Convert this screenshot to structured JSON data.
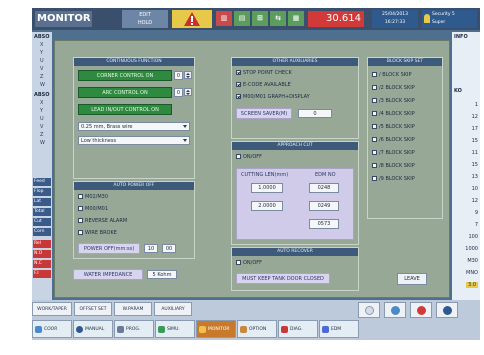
{
  "topbar": {
    "title": "MONITOR",
    "mode_line1": "EDIT",
    "mode_line2": "HOLD",
    "counter": "30.614",
    "clock_line1": "25/04/2013",
    "clock_line2": "16:27:33",
    "user_line1": "Security 5",
    "user_line2": "Super"
  },
  "left_strip": {
    "section1": "ABSO",
    "axes": [
      "X",
      "Y",
      "U",
      "V",
      "Z",
      "W"
    ],
    "section2": "ABSO",
    "axes2": [
      "X",
      "Y",
      "U",
      "V",
      "Z",
      "W"
    ],
    "items": [
      "Feed",
      "Flop",
      "Lat",
      "Total",
      "Cut",
      "Corn",
      "Rel",
      "N.O",
      "N.C",
      "F.I"
    ]
  },
  "right_strip": {
    "header": "INFO",
    "label": "KO",
    "numbers": [
      "1",
      "12",
      "17",
      "15",
      "11",
      "15",
      "13",
      "10",
      "12",
      "9",
      "7",
      "100",
      "1000",
      "M30",
      "MNO",
      "3.0"
    ]
  },
  "panel": {
    "wire_title": "CONTINUOUS FUNCTION",
    "corner_control": "CORNER CONTROL ON",
    "corner_value": "0",
    "arc_control": "ARC CONTROL ON",
    "arc_value": "0",
    "lead_control": "LEAD IN/OUT CONTROL ON",
    "wire_type": "0.25 mm, Brass wire",
    "thickness": "Low thickness",
    "auto_title": "AUTO POWER OFF",
    "auto_checks": [
      {
        "label": "M02/M30",
        "checked": false
      },
      {
        "label": "M00/M01",
        "checked": false
      },
      {
        "label": "REVERSE ALARM",
        "checked": false
      },
      {
        "label": "WIRE BROKE",
        "checked": false
      }
    ],
    "power_off_label": "POWER OFF(mm:ss)",
    "power_off_min": "10",
    "power_off_sec": "00",
    "water_label": "WATER IMPEDANCE",
    "water_value": "5 Kohm",
    "other_title": "OTHER AUXILIARIES",
    "other_checks": [
      {
        "label": "STOP POINT CHECK",
        "checked": true
      },
      {
        "label": "E-CODE AVAILABLE",
        "checked": true
      },
      {
        "label": "M00/M01 GRAPH+DISPLAY",
        "checked": true
      }
    ],
    "screen_saver_label": "SCREEN SAVER(M)",
    "screen_saver_value": "0",
    "approach_title": "APPROACH CUT",
    "approach_check": "ON/OFF",
    "cutting_header": "CUTTING LEN(mm)",
    "edm_header": "EDM NO",
    "cutting_rows": [
      {
        "len": "1.0000",
        "edm": "0248"
      },
      {
        "len": "2.0000",
        "edm": "0249"
      },
      {
        "len": "",
        "edm": "0573"
      }
    ],
    "auto_recover_title": "AUTO RECOVER",
    "recover_check": "ON/OFF",
    "recover_warning": "MUST KEEP TANK DOOR CLOSED",
    "block_title": "BLOCK SKIP SET",
    "block_skips": [
      "/ BLOCK SKIP",
      "/2 BLOCK SKIP",
      "/3 BLOCK SKIP",
      "/4 BLOCK SKIP",
      "/5 BLOCK SKIP",
      "/6 BLOCK SKIP",
      "/7 BLOCK SKIP",
      "/8 BLOCK SKIP",
      "/9 BLOCK SKIP"
    ],
    "leave_label": "LEAVE"
  },
  "bottombar": {
    "tabs": [
      "WORK/TAPER SET",
      "OFFSET SET",
      "W.PARAM",
      "AUXILIARY"
    ],
    "nav": [
      "COOR",
      "MANUAL",
      "PROG.",
      "SIMU.",
      "MONITOR",
      "OPTION",
      "DIAG.",
      "EDM"
    ],
    "active_nav": "MONITOR"
  }
}
